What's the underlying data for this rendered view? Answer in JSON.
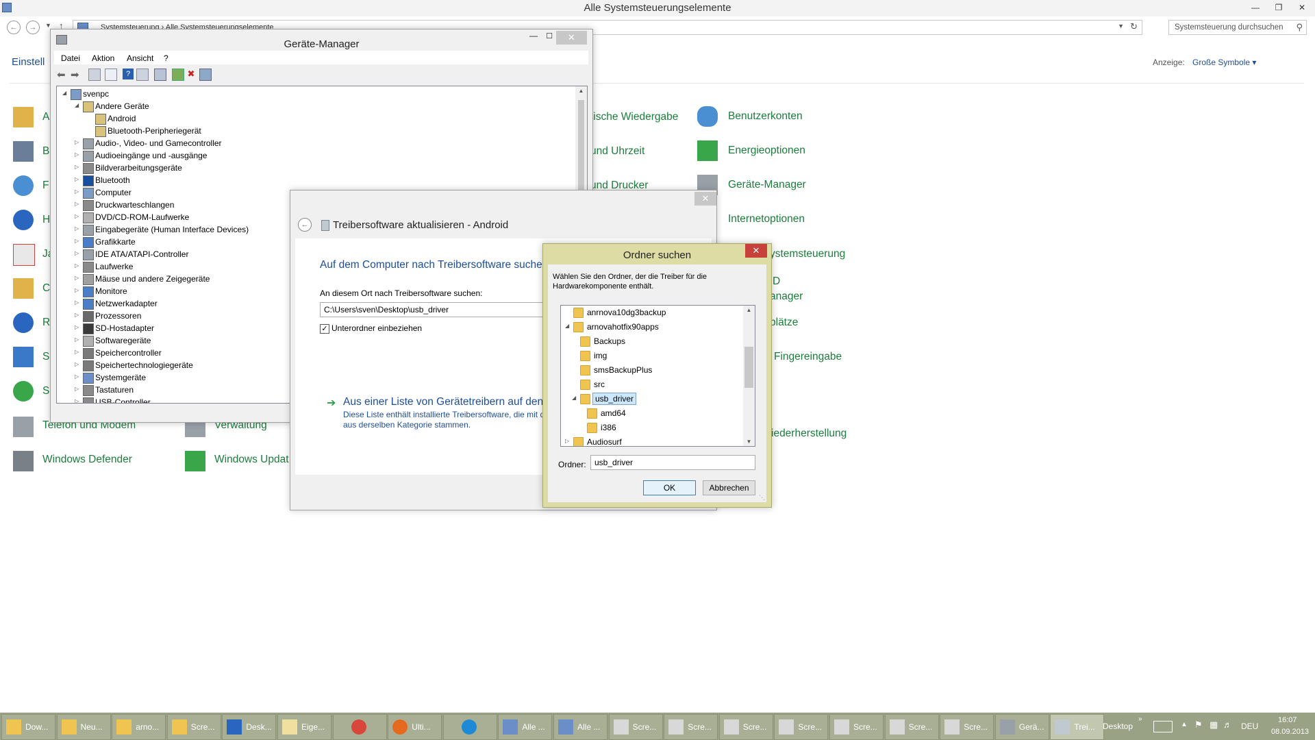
{
  "control_panel": {
    "title": "Alle Systemsteuerungselemente",
    "breadcrumb": "Systemsteuerung  ›  Alle Systemsteuerungselemente",
    "search_placeholder": "Systemsteuerung durchsuchen",
    "settings_label": "Einstell",
    "view_label": "Anzeige:",
    "view_value": "Große Symbole ▾",
    "items_left_col": [
      "A",
      "B",
      "F",
      "H",
      "Ja",
      "C",
      "R",
      "S",
      "S"
    ],
    "items_bottom": [
      "Telefon und Modem",
      "Verwaltung",
      "Windows Defender",
      "Windows Updat"
    ],
    "items_middle_col": [
      "tische Wiedergabe",
      "und Uhrzeit",
      "und Drucker",
      "ystemsteuerung",
      "D",
      "anager",
      "plätze",
      "Fingereingabe",
      "iederherstellung"
    ],
    "items_right_col": [
      "Benutzerkonten",
      "Energieoptionen",
      "Geräte-Manager",
      "Internetoptionen"
    ]
  },
  "device_manager": {
    "title": "Geräte-Manager",
    "menu": [
      "Datei",
      "Aktion",
      "Ansicht",
      "?"
    ],
    "tree": [
      {
        "label": "svenpc",
        "level": 0,
        "arrow": "◢",
        "icon": "computer"
      },
      {
        "label": "Andere Geräte",
        "level": 1,
        "arrow": "◢",
        "icon": "warning"
      },
      {
        "label": "Android",
        "level": 2,
        "arrow": "",
        "icon": "warning"
      },
      {
        "label": "Bluetooth-Peripheriegerät",
        "level": 2,
        "arrow": "",
        "icon": "warning"
      },
      {
        "label": "Audio-, Video- und Gamecontroller",
        "level": 1,
        "arrow": "▷",
        "icon": "speaker"
      },
      {
        "label": "Audioeingänge und -ausgänge",
        "level": 1,
        "arrow": "▷",
        "icon": "speaker"
      },
      {
        "label": "Bildverarbeitungsgeräte",
        "level": 1,
        "arrow": "▷",
        "icon": "camera"
      },
      {
        "label": "Bluetooth",
        "level": 1,
        "arrow": "▷",
        "icon": "bluetooth"
      },
      {
        "label": "Computer",
        "level": 1,
        "arrow": "▷",
        "icon": "computer"
      },
      {
        "label": "Druckwarteschlangen",
        "level": 1,
        "arrow": "▷",
        "icon": "printer"
      },
      {
        "label": "DVD/CD-ROM-Laufwerke",
        "level": 1,
        "arrow": "▷",
        "icon": "disc"
      },
      {
        "label": "Eingabegeräte (Human Interface Devices)",
        "level": 1,
        "arrow": "▷",
        "icon": "hid"
      },
      {
        "label": "Grafikkarte",
        "level": 1,
        "arrow": "▷",
        "icon": "display"
      },
      {
        "label": "IDE ATA/ATAPI-Controller",
        "level": 1,
        "arrow": "▷",
        "icon": "ide"
      },
      {
        "label": "Laufwerke",
        "level": 1,
        "arrow": "▷",
        "icon": "drive"
      },
      {
        "label": "Mäuse und andere Zeigegeräte",
        "level": 1,
        "arrow": "▷",
        "icon": "mouse"
      },
      {
        "label": "Monitore",
        "level": 1,
        "arrow": "▷",
        "icon": "display"
      },
      {
        "label": "Netzwerkadapter",
        "level": 1,
        "arrow": "▷",
        "icon": "network"
      },
      {
        "label": "Prozessoren",
        "level": 1,
        "arrow": "▷",
        "icon": "cpu"
      },
      {
        "label": "SD-Hostadapter",
        "level": 1,
        "arrow": "▷",
        "icon": "sd"
      },
      {
        "label": "Softwaregeräte",
        "level": 1,
        "arrow": "▷",
        "icon": "software"
      },
      {
        "label": "Speichercontroller",
        "level": 1,
        "arrow": "▷",
        "icon": "storage"
      },
      {
        "label": "Speichertechnologiegeräte",
        "level": 1,
        "arrow": "▷",
        "icon": "storage"
      },
      {
        "label": "Systemgeräte",
        "level": 1,
        "arrow": "▷",
        "icon": "system"
      },
      {
        "label": "Tastaturen",
        "level": 1,
        "arrow": "▷",
        "icon": "keyboard"
      },
      {
        "label": "USB-Controller",
        "level": 1,
        "arrow": "▷",
        "icon": "usb"
      }
    ]
  },
  "wizard": {
    "title": "Treibersoftware aktualisieren - Android",
    "heading": "Auf dem Computer nach Treibersoftware suche",
    "location_label": "An diesem Ort nach Treibersoftware suchen:",
    "path_value": "C:\\Users\\sven\\Desktop\\usb_driver",
    "subfolder_label": "Unterordner einbeziehen",
    "subfolder_checked": "✓",
    "list_link": "Aus einer Liste von Gerätetreibern auf den",
    "list_desc_line1": "Diese Liste enthält installierte Treibersoftware, die mit d",
    "list_desc_line2": "aus derselben Kategorie stammen."
  },
  "folder_dialog": {
    "title": "Ordner suchen",
    "desc_line1": "Wählen Sie den Ordner, der die Treiber für die",
    "desc_line2": "Hardwarekomponente enthält.",
    "tree": [
      {
        "label": "anrnova10dg3backup",
        "level": 0,
        "arrow": "",
        "selected": false
      },
      {
        "label": "arnovahotfix90apps",
        "level": 0,
        "arrow": "◢",
        "selected": false
      },
      {
        "label": "Backups",
        "level": 1,
        "arrow": "",
        "selected": false
      },
      {
        "label": "img",
        "level": 1,
        "arrow": "",
        "selected": false
      },
      {
        "label": "smsBackupPlus",
        "level": 1,
        "arrow": "",
        "selected": false
      },
      {
        "label": "src",
        "level": 1,
        "arrow": "",
        "selected": false
      },
      {
        "label": "usb_driver",
        "level": 1,
        "arrow": "◢",
        "selected": true
      },
      {
        "label": "amd64",
        "level": 2,
        "arrow": "",
        "selected": false
      },
      {
        "label": "i386",
        "level": 2,
        "arrow": "",
        "selected": false
      },
      {
        "label": "Audiosurf",
        "level": 0,
        "arrow": "▷",
        "selected": false
      }
    ],
    "folder_label": "Ordner:",
    "folder_value": "usb_driver",
    "ok_label": "OK",
    "cancel_label": "Abbrechen"
  },
  "taskbar": {
    "tasks": [
      {
        "label": "Dow...",
        "icon": "folder-icon"
      },
      {
        "label": "Neu...",
        "icon": "folder-icon"
      },
      {
        "label": "arno...",
        "icon": "folder-icon"
      },
      {
        "label": "Scre...",
        "icon": "folder-icon"
      },
      {
        "label": "Desk...",
        "icon": "desktop-icon"
      },
      {
        "label": "Eige...",
        "icon": "document-icon"
      },
      {
        "label": "",
        "icon": "chrome-icon"
      },
      {
        "label": "Ulti...",
        "icon": "firefox-icon"
      },
      {
        "label": "",
        "icon": "ie-icon"
      },
      {
        "label": "Alle ...",
        "icon": "control-panel-icon"
      },
      {
        "label": "Alle ...",
        "icon": "control-panel-icon"
      },
      {
        "label": "Scre...",
        "icon": "paint-icon"
      },
      {
        "label": "Scre...",
        "icon": "paint-icon"
      },
      {
        "label": "Scre...",
        "icon": "paint-icon"
      },
      {
        "label": "Scre...",
        "icon": "paint-icon"
      },
      {
        "label": "Scre...",
        "icon": "paint-icon"
      },
      {
        "label": "Scre...",
        "icon": "paint-icon"
      },
      {
        "label": "Scre...",
        "icon": "paint-icon"
      },
      {
        "label": "Gerä...",
        "icon": "device-manager-icon"
      },
      {
        "label": "Trei...",
        "icon": "driver-icon"
      }
    ],
    "desktop_label": "Desktop",
    "lang": "DEU",
    "time": "16:07",
    "date": "08.09.2013"
  }
}
